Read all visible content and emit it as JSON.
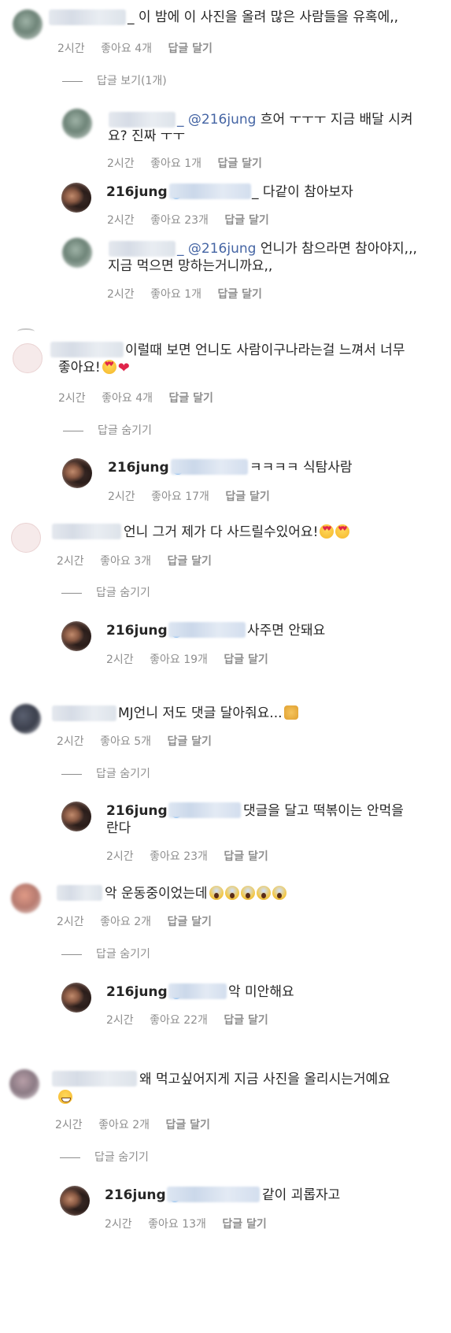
{
  "c1": {
    "text": "_ 이 밤에 이 사진을 올려 많은 사람들을 유혹에,,",
    "time": "2시간",
    "likes": "좋아요 4개",
    "reply": "답글 달기",
    "toggle": "답글 보기(1개)"
  },
  "c1r1": {
    "mention": "_ @216jung",
    "text": " 흐어 ㅜㅜㅜ 지금 배달 시켜",
    "text2": "요? 진짜 ㅜㅜ",
    "time": "2시간",
    "likes": "좋아요 1개",
    "reply": "답글 달기"
  },
  "c1r2": {
    "username": "216jung",
    "text": "_ 다같이 참아보자",
    "time": "2시간",
    "likes": "좋아요 23개",
    "reply": "답글 달기"
  },
  "c1r3": {
    "mention": "_ @216jung",
    "text": " 언니가 참으라면 참아야지,,,",
    "text2": "지금 먹으면 망하는거니까요,,",
    "time": "2시간",
    "likes": "좋아요 1개",
    "reply": "답글 달기"
  },
  "c2": {
    "text": "이럴때 보면 언니도 사람이구나라는걸 느껴서 너무",
    "text2": "좋아요!",
    "time": "2시간",
    "likes": "좋아요 4개",
    "reply": "답글 달기",
    "toggle": "답글 숨기기"
  },
  "c2r1": {
    "username": "216jung",
    "text": "ㅋㅋㅋㅋ 식탐사람",
    "time": "2시간",
    "likes": "좋아요 17개",
    "reply": "답글 달기"
  },
  "c3": {
    "text": "언니 그거 제가 다 사드릴수있어요!",
    "time": "2시간",
    "likes": "좋아요 3개",
    "reply": "답글 달기",
    "toggle": "답글 숨기기"
  },
  "c3r1": {
    "username": "216jung",
    "text": "사주면 안돼요",
    "time": "2시간",
    "likes": "좋아요 19개",
    "reply": "답글 달기"
  },
  "c4": {
    "text": "MJ언니 저도 댓글 달아줘요...",
    "time": "2시간",
    "likes": "좋아요 5개",
    "reply": "답글 달기",
    "toggle": "답글 숨기기"
  },
  "c4r1": {
    "username": "216jung",
    "text": "댓글을 달고 떡볶이는 안먹을",
    "text2": "란다",
    "time": "2시간",
    "likes": "좋아요 23개",
    "reply": "답글 달기"
  },
  "c5": {
    "text": "악 운동중이었는데",
    "time": "2시간",
    "likes": "좋아요 2개",
    "reply": "답글 달기",
    "toggle": "답글 숨기기"
  },
  "c5r1": {
    "username": "216jung",
    "text": "악 미안해요",
    "time": "2시간",
    "likes": "좋아요 22개",
    "reply": "답글 달기"
  },
  "c6": {
    "text": "왜 먹고싶어지게 지금 사진을 올리시는거예요",
    "time": "2시간",
    "likes": "좋아요 2개",
    "reply": "답글 달기",
    "toggle": "답글 숨기기"
  },
  "c6r1": {
    "username": "216jung",
    "text": "같이 괴롭자고",
    "time": "2시간",
    "likes": "좋아요 13개",
    "reply": "답글 달기"
  },
  "colors": {
    "text": "#262626",
    "meta": "#8e8e8e",
    "mention": "#4565a4",
    "verified": "#3897f0"
  },
  "icons": {
    "verified": "verified-badge-icon",
    "heart_eyes": "heart-eyes-emoji",
    "heart": "red-heart-emoji",
    "scream": "scream-emoji",
    "hands": "raised-hands-emoji",
    "grin": "grin-emoji"
  }
}
